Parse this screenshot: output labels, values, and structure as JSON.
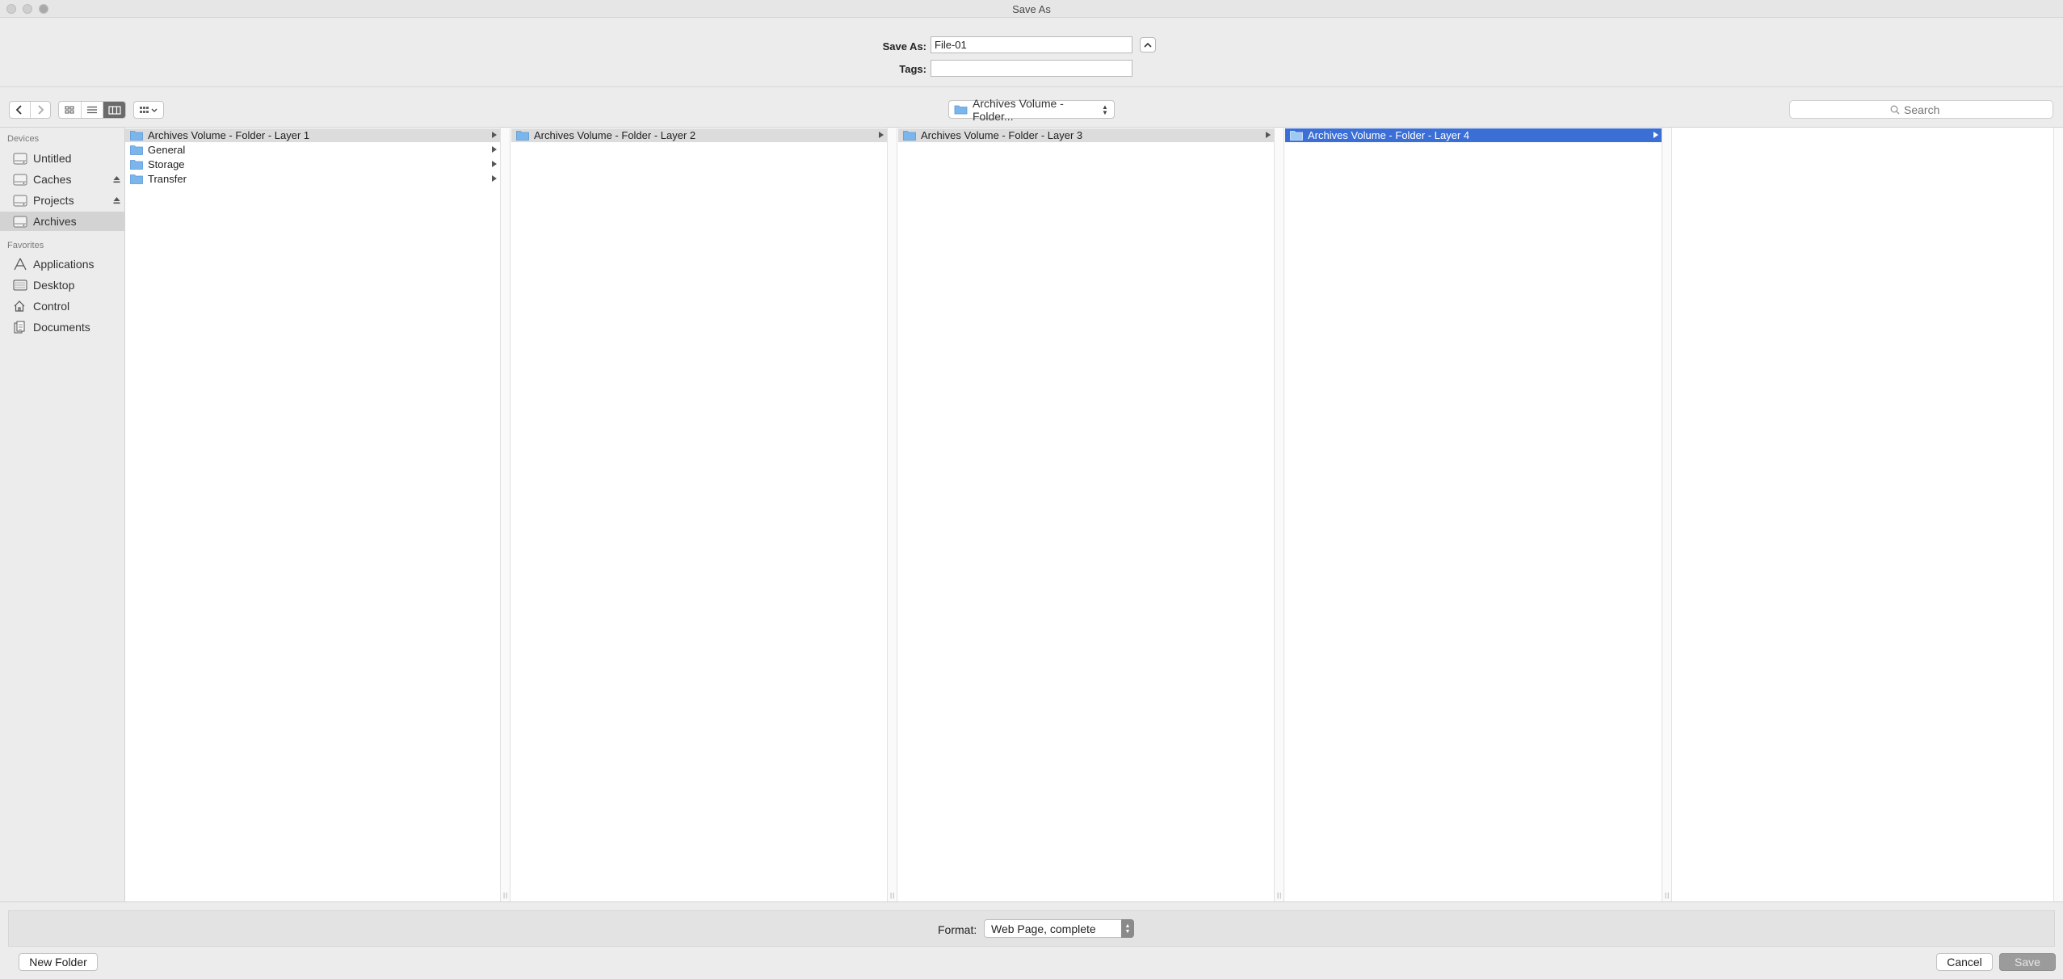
{
  "window": {
    "title": "Save As"
  },
  "save": {
    "save_as_label": "Save As:",
    "filename": "File-01",
    "tags_label": "Tags:",
    "tags_value": ""
  },
  "toolbar": {
    "path_label": "Archives Volume - Folder...",
    "search_placeholder": "Search"
  },
  "sidebar": {
    "devices_header": "Devices",
    "devices": [
      {
        "label": "Untitled",
        "icon": "disk-icon",
        "eject": false
      },
      {
        "label": "Caches",
        "icon": "disk-icon",
        "eject": true
      },
      {
        "label": "Projects",
        "icon": "disk-icon",
        "eject": true
      },
      {
        "label": "Archives",
        "icon": "disk-icon",
        "eject": false,
        "selected": true
      }
    ],
    "favorites_header": "Favorites",
    "favorites": [
      {
        "label": "Applications",
        "icon": "applications-icon"
      },
      {
        "label": "Desktop",
        "icon": "desktop-icon"
      },
      {
        "label": "Control",
        "icon": "home-icon"
      },
      {
        "label": "Documents",
        "icon": "documents-icon"
      }
    ]
  },
  "columns": [
    {
      "items": [
        {
          "label": "Archives Volume - Folder - Layer 1",
          "state": "gray"
        },
        {
          "label": "General"
        },
        {
          "label": "Storage"
        },
        {
          "label": "Transfer"
        }
      ]
    },
    {
      "items": [
        {
          "label": "Archives Volume - Folder - Layer 2",
          "state": "gray"
        }
      ]
    },
    {
      "items": [
        {
          "label": "Archives Volume - Folder - Layer 3",
          "state": "gray"
        }
      ]
    },
    {
      "items": [
        {
          "label": "Archives Volume - Folder - Layer 4",
          "state": "blue"
        }
      ]
    }
  ],
  "format": {
    "label": "Format:",
    "value": "Web Page, complete"
  },
  "buttons": {
    "new_folder": "New Folder",
    "cancel": "Cancel",
    "save": "Save"
  },
  "colors": {
    "selection_blue": "#3b6fd6",
    "folder_blue": "#7ab6ec"
  }
}
